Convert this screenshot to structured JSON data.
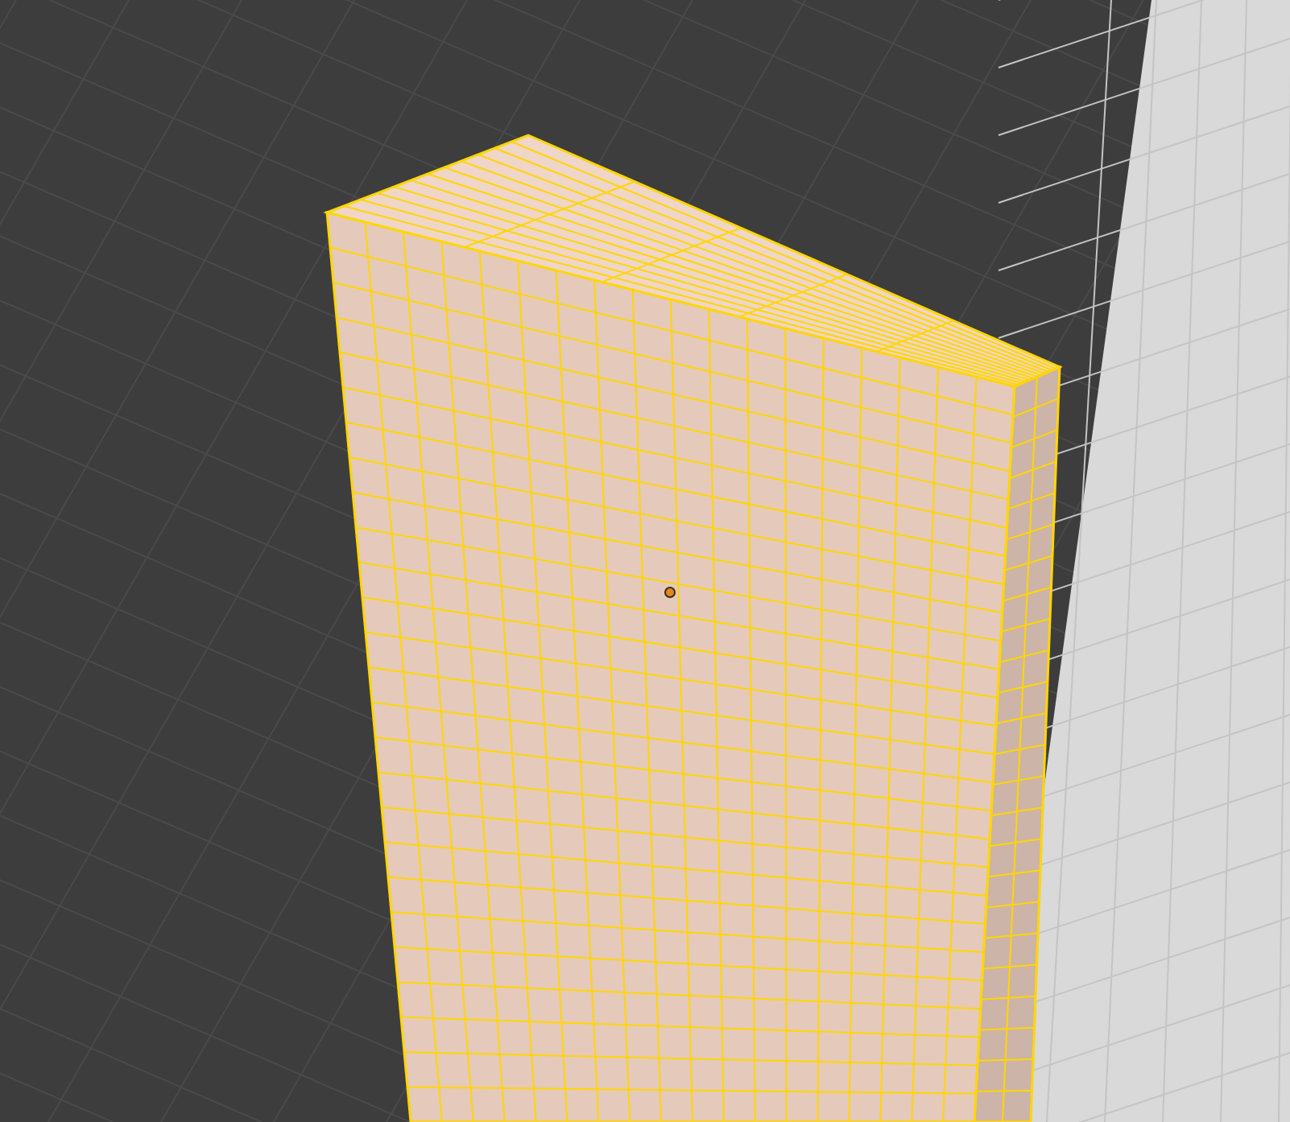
{
  "objects": [
    {
      "kind": "box-mesh",
      "selected": true
    }
  ]
}
